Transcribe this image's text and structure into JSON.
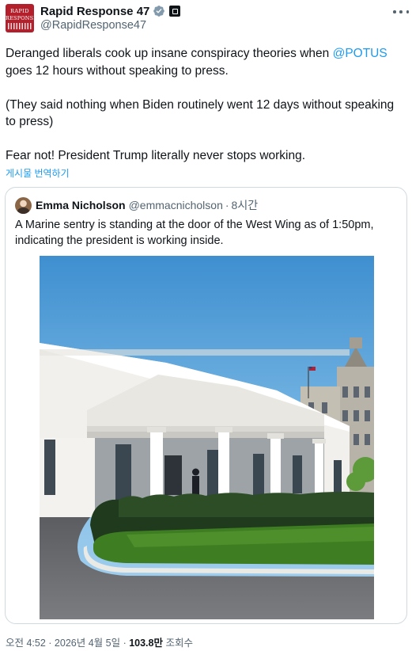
{
  "post": {
    "avatar_text": [
      "RAPID",
      "RESPONSE"
    ],
    "display_name": "Rapid Response 47",
    "handle": "@RapidResponse47",
    "text_line1_before": "Deranged liberals cook up insane conspiracy theories when ",
    "mention": "@POTUS",
    "text_line2": "goes 12 hours without speaking to press.",
    "text_para2": "(They said nothing when Biden routinely went 12 days without speaking to press)",
    "text_para3": "Fear not! President Trump literally never stops working.",
    "translate_label": "게시물 번역하기"
  },
  "quote": {
    "display_name": "Emma Nicholson",
    "handle": "@emmacnicholson",
    "separator": "·",
    "time": "8시간",
    "text": "A Marine sentry is standing at the door of the West Wing as of 1:50pm, indicating the president is working inside."
  },
  "meta": {
    "time": "오전 4:52",
    "sep1": " · ",
    "date": "2026년 4월 5일",
    "sep2": " · ",
    "views_count": "103.8만",
    "views_label": " 조회수"
  },
  "icons": {
    "verified": "verified-badge-icon",
    "affiliation": "affiliation-badge-icon",
    "more": "more-options-icon"
  },
  "colors": {
    "accent": "#1d9bf0",
    "text": "#0f1419",
    "secondary": "#536471",
    "border": "#cfd9de",
    "avatar_brand": "#b3202c"
  }
}
